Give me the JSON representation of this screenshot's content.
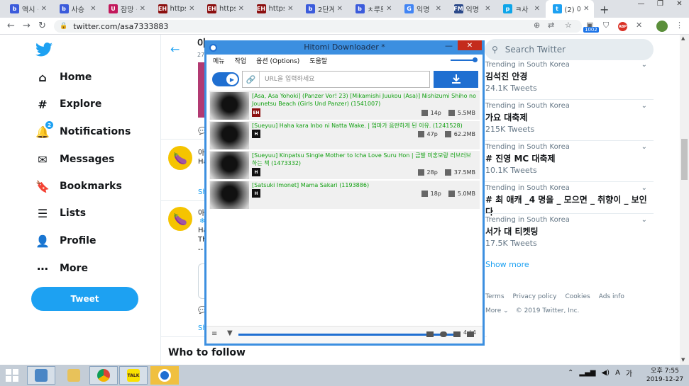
{
  "browser": {
    "tabs": [
      {
        "label": "액시 ·",
        "fav_color": "#3b5bdb",
        "fav_text": "b"
      },
      {
        "label": "사승 ·",
        "fav_color": "#3b5bdb",
        "fav_text": "b"
      },
      {
        "label": "잠망 ·",
        "fav_color": "#c2185b",
        "fav_text": "U"
      },
      {
        "label": "https:",
        "fav_color": "#8b0f0f",
        "fav_text": "EH"
      },
      {
        "label": "https:",
        "fav_color": "#8b0f0f",
        "fav_text": "EH"
      },
      {
        "label": "https:",
        "fav_color": "#8b0f0f",
        "fav_text": "EH"
      },
      {
        "label": "2단계",
        "fav_color": "#3b5bdb",
        "fav_text": "b"
      },
      {
        "label": "ㅊ루트",
        "fav_color": "#3b5bdb",
        "fav_text": "b"
      },
      {
        "label": "익명",
        "fav_color": "#4285f4",
        "fav_text": "G"
      },
      {
        "label": "익명",
        "fav_color": "#2c4a8a",
        "fav_text": "FM"
      },
      {
        "label": "ㅋ사",
        "fav_color": "#0ea5e9",
        "fav_text": "p"
      },
      {
        "label": "(2) 아",
        "fav_color": "#1da1f2",
        "fav_text": "t"
      }
    ],
    "active_tab_index": 11,
    "new_tab_symbol": "+",
    "url": "twitter.com/asa7333883",
    "ext_badge": "1002",
    "abp_label": "ABP",
    "window_controls": {
      "minimize": "—",
      "restore": "❐",
      "close": "✕"
    }
  },
  "twitter": {
    "nav": [
      {
        "label": "Home",
        "icon": "home-icon",
        "glyph": "⌂"
      },
      {
        "label": "Explore",
        "icon": "hashtag-icon",
        "glyph": "#"
      },
      {
        "label": "Notifications",
        "icon": "bell-icon",
        "glyph": "🔔",
        "badge": "2"
      },
      {
        "label": "Messages",
        "icon": "envelope-icon",
        "glyph": "✉"
      },
      {
        "label": "Bookmarks",
        "icon": "bookmark-icon",
        "glyph": "🔖"
      },
      {
        "label": "Lists",
        "icon": "list-icon",
        "glyph": "☰"
      },
      {
        "label": "Profile",
        "icon": "profile-icon",
        "glyph": "👤"
      },
      {
        "label": "More",
        "icon": "more-icon",
        "glyph": "⋯"
      }
    ],
    "tweet_button": "Tweet",
    "center": {
      "profile_name_fragment": "아",
      "profile_count_fragment": "27",
      "tweet_fragments": [
        "아",
        "Ha",
        "Sh",
        "아",
        "Ha",
        "Th",
        "--",
        "Sh"
      ],
      "who_to_follow": "Who to follow"
    },
    "search_placeholder": "Search Twitter",
    "trends": [
      {
        "meta": "Trending in South Korea",
        "name": "김석진 안경",
        "count": "24.1K Tweets"
      },
      {
        "meta": "Trending in South Korea",
        "name": "가요 대축제",
        "count": "215K Tweets"
      },
      {
        "meta": "Trending in South Korea",
        "name": "# 진영 MC 대축제",
        "count": "10.1K Tweets"
      },
      {
        "meta": "Trending in South Korea",
        "name": "# 최 애캐 _4 명을 _ 모으면 _ 취향이 _ 보인다",
        "count": ""
      },
      {
        "meta": "Trending in South Korea",
        "name": "서가 대 티켓팅",
        "count": "17.5K Tweets"
      }
    ],
    "show_more": "Show more",
    "footer": {
      "links": [
        "Terms",
        "Privacy policy",
        "Cookies",
        "Ads info"
      ],
      "more": "More",
      "copyright": "© 2019 Twitter, Inc."
    }
  },
  "hitomi": {
    "title": "Hitomi Downloader *",
    "menu": [
      "메뉴",
      "작업",
      "옵션 (Options)",
      "도움말"
    ],
    "url_placeholder": "URL을 입력하세요",
    "items": [
      {
        "title": "[Asa, Asa Yohoki] (Panzer Vor! 23) [Mikamishi Juukou (Asa)] Nishizumi Shiho no Jounetsu Beach (Girls Und Panzer) (1541007)",
        "site": "EH",
        "pages": "14p",
        "size": "5.5MB"
      },
      {
        "title": "[Sueyuu] Haha kara Inbo ni Natta Wake. | 엄마가 음란하게 된 이유. (1241528)",
        "site": "H",
        "pages": "47p",
        "size": "62.2MB"
      },
      {
        "title": "[Sueyuu] Kinpatsu Single Mother to Icha Love Suru Hon | 금발 미혼모랑 러브러브 하는 책 (1473332)",
        "site": "H",
        "pages": "28p",
        "size": "37.5MB"
      },
      {
        "title": "[Satsuki Imonet] Mama Sakari (1193886)",
        "site": "H",
        "pages": "18p",
        "size": "5.0MB"
      }
    ],
    "progress_count": "4 / 4",
    "progress_fraction": 1.0,
    "accent_color": "#1f6fd1"
  },
  "taskbar": {
    "apps": [
      "app-icon",
      "file-explorer-icon",
      "chrome-icon",
      "kakaotalk-icon",
      "hitomi-icon"
    ],
    "kakao_label": "TALK",
    "ime": "A",
    "ime2": "가",
    "time_label": "오후 7:55",
    "date": "2019-12-27"
  }
}
